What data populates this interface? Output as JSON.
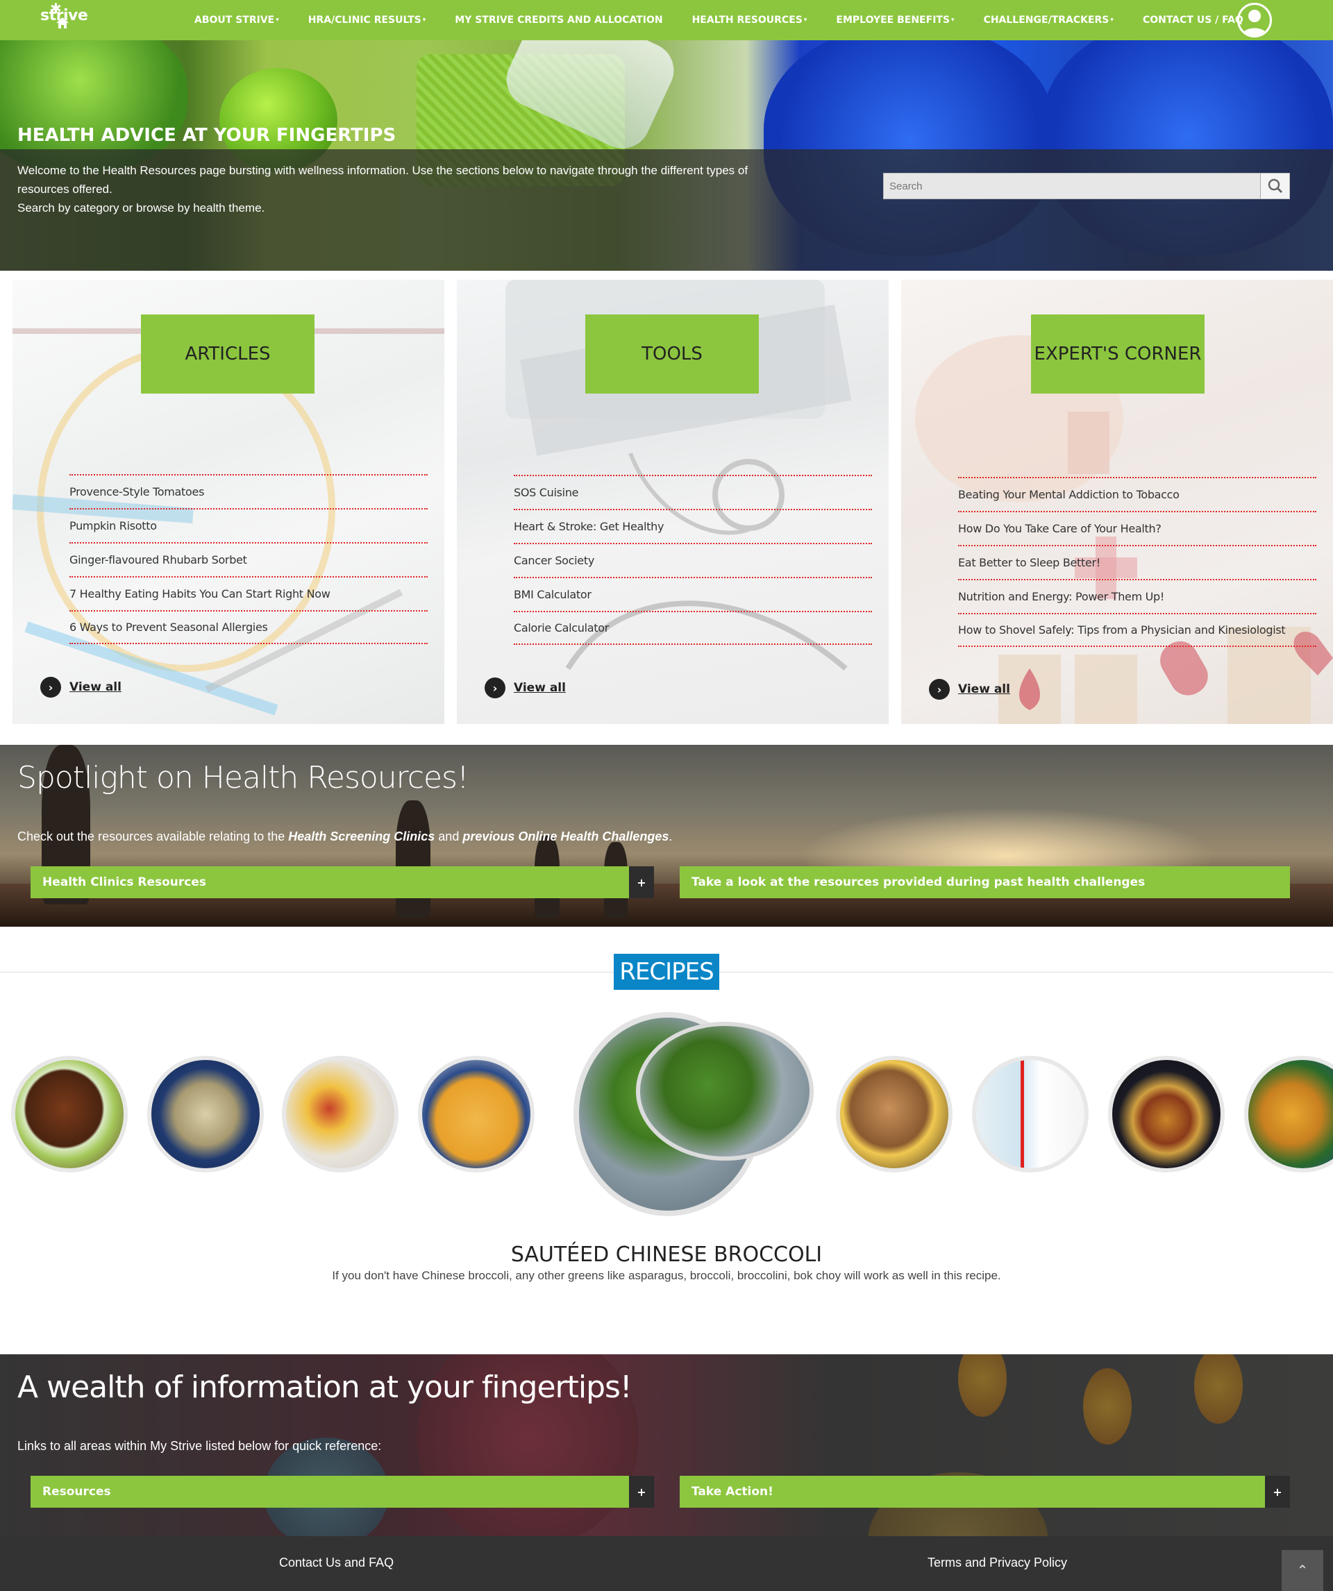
{
  "nav": {
    "logo": "strive",
    "items": [
      {
        "label": "ABOUT STRIVE",
        "has_menu": true
      },
      {
        "label": "HRA/CLINIC RESULTS",
        "has_menu": true
      },
      {
        "label": "MY STRIVE CREDITS AND ALLOCATION",
        "has_menu": false
      },
      {
        "label": "HEALTH RESOURCES",
        "has_menu": true
      },
      {
        "label": "EMPLOYEE BENEFITS",
        "has_menu": true
      },
      {
        "label": "CHALLENGE/TRACKERS",
        "has_menu": true
      },
      {
        "label": "CONTACT US / FAQ",
        "has_menu": false
      }
    ],
    "caret": "▾"
  },
  "hero": {
    "title": "HEALTH ADVICE AT YOUR FINGERTIPS",
    "line1": "Welcome to the Health Resources page bursting with wellness information. Use the sections below to navigate through the different types of resources offered.",
    "line2": "Search by category or browse by health theme.",
    "search_placeholder": "Search"
  },
  "cards": [
    {
      "label": "ARTICLES",
      "items": [
        "Provence-Style Tomatoes",
        "Pumpkin Risotto",
        "Ginger-flavoured Rhubarb Sorbet",
        "7 Healthy Eating Habits You Can Start Right Now",
        "6 Ways to Prevent Seasonal Allergies"
      ],
      "view_all": "View all"
    },
    {
      "label": "TOOLS",
      "items": [
        "SOS Cuisine",
        "Heart & Stroke: Get Healthy",
        "Cancer Society",
        "BMI Calculator",
        "Calorie Calculator"
      ],
      "view_all": "View all"
    },
    {
      "label": "EXPERT'S CORNER",
      "items": [
        "Beating Your Mental Addiction to Tobacco",
        "How Do You Take Care of Your Health?",
        "Eat Better to Sleep Better!",
        "Nutrition and Energy: Power Them Up!",
        "How to Shovel Safely: Tips from a Physician and Kinesiologist"
      ],
      "view_all": "View all"
    }
  ],
  "spotlight": {
    "title": "Spotlight on Health Resources!",
    "text_pre": "Check out the resources available relating to the ",
    "text_em1": "Health Screening Clinics",
    "text_mid": " and ",
    "text_em2": "previous Online Health Challenges",
    "text_post": ".",
    "acc1": "Health Clinics Resources",
    "acc2": "Take a look at the resources provided during past health challenges",
    "plus": "+"
  },
  "recipes": {
    "title": "RECIPES",
    "featured_name": "SAUTÉED CHINESE BROCCOLI",
    "featured_desc": "If you don't have Chinese broccoli, any other greens like asparagus, broccoli, broccolini, bok choy will work as well in this recipe."
  },
  "wealth": {
    "title": "A wealth of information at your fingertips!",
    "text": "Links to all areas within My Strive listed below for quick reference:",
    "acc1": "Resources",
    "acc2": "Take Action!",
    "plus": "+"
  },
  "footer": {
    "contact": "Contact Us and FAQ",
    "terms": "Terms and Privacy Policy",
    "to_top": "⌃"
  },
  "colors": {
    "brand_green": "#8cc63f",
    "recipes_blue": "#0a86c7",
    "footer": "#333333",
    "divider_red": "#e02424"
  }
}
